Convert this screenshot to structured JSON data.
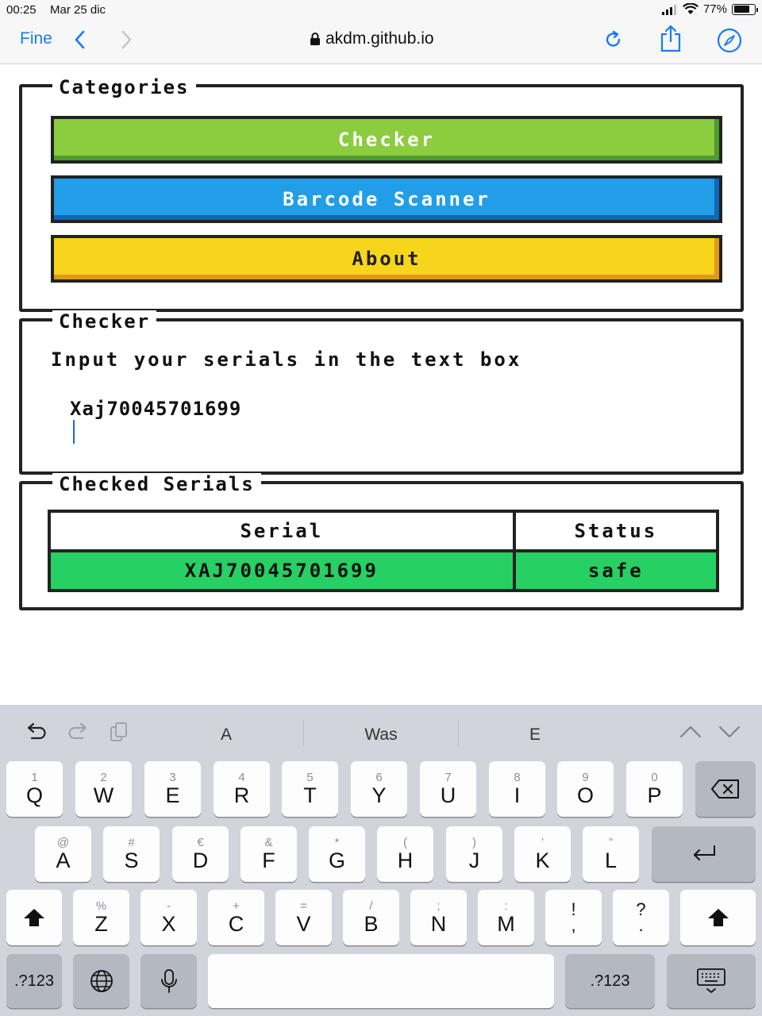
{
  "status_bar": {
    "time": "00:25",
    "date": "Mar 25 dic",
    "battery": "77%",
    "battery_level": 0.77
  },
  "browser": {
    "done_label": "Fine",
    "url": "akdm.github.io"
  },
  "categories": {
    "legend": "Categories",
    "buttons": [
      {
        "label": "Checker",
        "color": "#8ccc3f"
      },
      {
        "label": "Barcode Scanner",
        "color": "#229ee8"
      },
      {
        "label": "About",
        "color": "#f6d51c"
      }
    ]
  },
  "checker": {
    "legend": "Checker",
    "prompt": "Input your serials in the text box",
    "input_value": "Xaj70045701699"
  },
  "checked_serials": {
    "legend": "Checked Serials",
    "columns": [
      "Serial",
      "Status"
    ],
    "rows": [
      {
        "serial": "XAJ70045701699",
        "status": "safe",
        "color": "#26d063"
      }
    ]
  },
  "keyboard": {
    "suggestions": [
      "A",
      "Was",
      "E"
    ],
    "row1": [
      {
        "hint": "1",
        "key": "Q"
      },
      {
        "hint": "2",
        "key": "W"
      },
      {
        "hint": "3",
        "key": "E"
      },
      {
        "hint": "4",
        "key": "R"
      },
      {
        "hint": "5",
        "key": "T"
      },
      {
        "hint": "6",
        "key": "Y"
      },
      {
        "hint": "7",
        "key": "U"
      },
      {
        "hint": "8",
        "key": "I"
      },
      {
        "hint": "9",
        "key": "O"
      },
      {
        "hint": "0",
        "key": "P"
      }
    ],
    "row2": [
      {
        "hint": "@",
        "key": "A"
      },
      {
        "hint": "#",
        "key": "S"
      },
      {
        "hint": "€",
        "key": "D"
      },
      {
        "hint": "&",
        "key": "F"
      },
      {
        "hint": "*",
        "key": "G"
      },
      {
        "hint": "(",
        "key": "H"
      },
      {
        "hint": ")",
        "key": "J"
      },
      {
        "hint": "’",
        "key": "K"
      },
      {
        "hint": "”",
        "key": "L"
      }
    ],
    "row3": [
      {
        "hint": "%",
        "key": "Z"
      },
      {
        "hint": "-",
        "key": "X"
      },
      {
        "hint": "+",
        "key": "C"
      },
      {
        "hint": "=",
        "key": "V"
      },
      {
        "hint": "/",
        "key": "B"
      },
      {
        "hint": ";",
        "key": "N"
      },
      {
        "hint": ":",
        "key": "M"
      }
    ],
    "punct1": {
      "top": "!",
      "bottom": ","
    },
    "punct2": {
      "top": "?",
      "bottom": "."
    },
    "numbers_label": ".?123",
    "icons": {
      "undo": "undo-icon",
      "redo": "redo-icon",
      "paste": "paste-icon",
      "up": "chevron-up-icon",
      "down": "chevron-down-icon",
      "backspace": "backspace-icon",
      "return": "return-icon",
      "shift": "shift-icon",
      "globe": "globe-icon",
      "mic": "microphone-icon",
      "hide": "keyboard-dismiss-icon"
    }
  }
}
